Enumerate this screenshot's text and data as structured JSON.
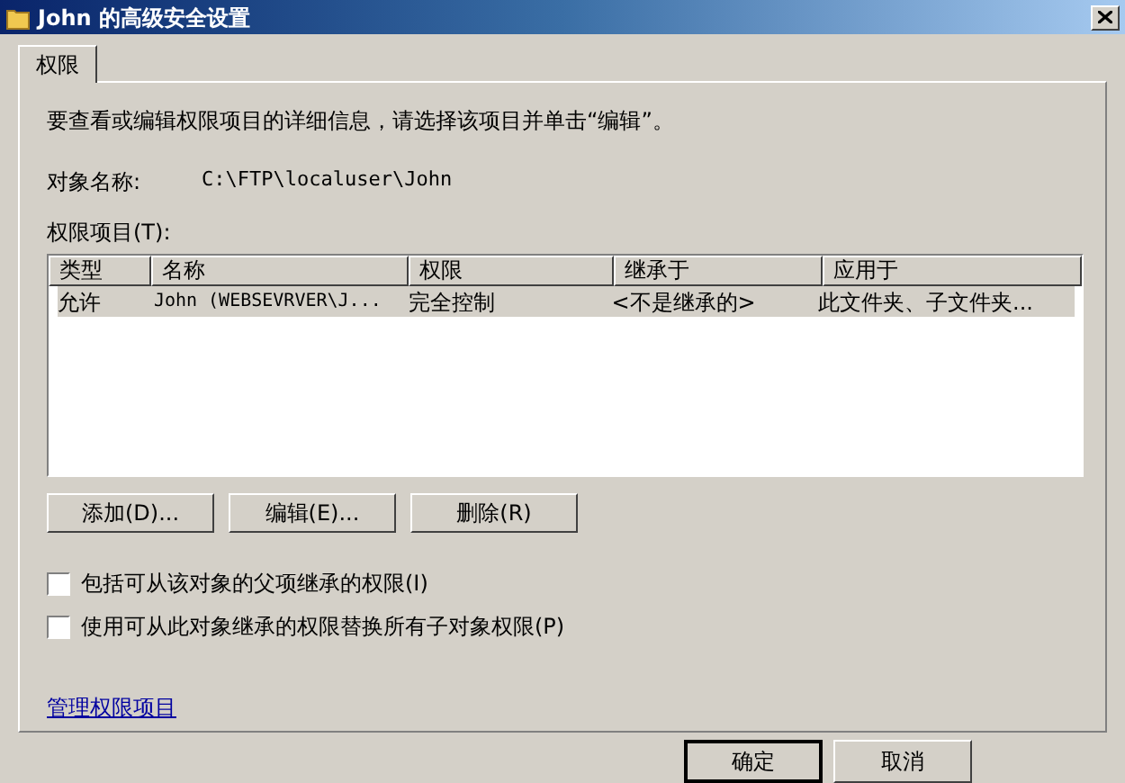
{
  "window": {
    "title": "John 的高级安全设置"
  },
  "tabs": [
    {
      "label": "权限",
      "selected": true
    }
  ],
  "description": "要查看或编辑权限项目的详细信息，请选择该项目并单击“编辑”。",
  "object_name": {
    "label": "对象名称:",
    "value": "C:\\FTP\\localuser\\John"
  },
  "list_label": "权限项目(T):",
  "table": {
    "columns": [
      "类型",
      "名称",
      "权限",
      "继承于",
      "应用于"
    ],
    "rows": [
      {
        "selected": true,
        "cells": [
          "允许",
          "John (WEBSEVRVER\\J...",
          "完全控制",
          "<不是继承的>",
          "此文件夹、子文件夹..."
        ]
      }
    ]
  },
  "buttons": [
    "添加(D)...",
    "编辑(E)...",
    "删除(R)"
  ],
  "checkboxes": [
    {
      "label": "包括可从该对象的父项继承的权限(I)",
      "checked": false
    },
    {
      "label": "使用可从此对象继承的权限替换所有子对象权限(P)",
      "checked": false
    }
  ],
  "link": "管理权限项目",
  "dialog_buttons": [
    {
      "label": "确定",
      "default": true
    },
    {
      "label": "取消",
      "default": false
    }
  ]
}
